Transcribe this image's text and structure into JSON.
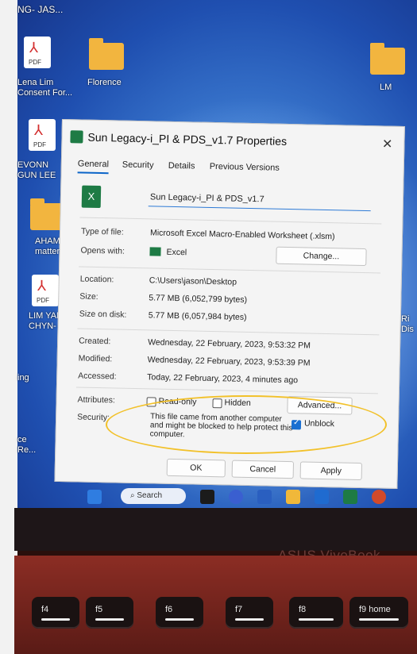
{
  "desktop": {
    "top_label": "NG- JAS...",
    "icons": [
      {
        "label": "Lena Lim Consent For...",
        "type": "pdf",
        "badge": "PDF"
      },
      {
        "label": "Florence",
        "type": "folder"
      },
      {
        "label": "LM",
        "type": "folder"
      },
      {
        "label": "EVONN GUN LEE",
        "type": "pdf",
        "badge": "PDF"
      },
      {
        "label": "AHAM matters",
        "type": "folder"
      },
      {
        "label": "LIM YAN CHYN- JA",
        "type": "pdf",
        "badge": "PDF"
      },
      {
        "label": "Ri Dis",
        "type": "file"
      },
      {
        "label": "ing",
        "type": "file"
      },
      {
        "label": "ce Re...",
        "type": "file"
      }
    ]
  },
  "dialog": {
    "title": "Sun Legacy-i_PI & PDS_v1.7 Properties",
    "close_glyph": "✕",
    "tabs": [
      "General",
      "Security",
      "Details",
      "Previous Versions"
    ],
    "active_tab": "General",
    "file_name": "Sun Legacy-i_PI & PDS_v1.7",
    "file_icon_letter": "X",
    "rows": {
      "type_label": "Type of file:",
      "type_value": "Microsoft Excel Macro-Enabled Worksheet (.xlsm)",
      "opens_label": "Opens with:",
      "opens_value": "Excel",
      "change_label": "Change...",
      "location_label": "Location:",
      "location_value": "C:\\Users\\jason\\Desktop",
      "size_label": "Size:",
      "size_value": "5.77 MB (6,052,799 bytes)",
      "size_on_disk_label": "Size on disk:",
      "size_on_disk_value": "5.77 MB (6,057,984 bytes)",
      "created_label": "Created:",
      "created_value": "Wednesday, 22 February, 2023, 9:53:32 PM",
      "modified_label": "Modified:",
      "modified_value": "Wednesday, 22 February, 2023, 9:53:39 PM",
      "accessed_label": "Accessed:",
      "accessed_value": "Today, 22 February, 2023, 4 minutes ago",
      "attributes_label": "Attributes:",
      "readonly_label": "Read-only",
      "hidden_label": "Hidden",
      "advanced_label": "Advanced...",
      "security_label": "Security:",
      "security_msg": "This file came from another computer and might be blocked to help protect this computer.",
      "unblock_label": "Unblock",
      "unblock_checked": true
    },
    "buttons": {
      "ok": "OK",
      "cancel": "Cancel",
      "apply": "Apply"
    }
  },
  "taskbar": {
    "search_label": "Search",
    "icons": [
      "windows-icon",
      "search-icon",
      "task-view-icon",
      "meet-icon",
      "word-icon",
      "file-explorer-icon",
      "mail-icon",
      "excel-icon",
      "powerpoint-icon"
    ]
  },
  "laptop": {
    "brand": "ASUS VivoBook",
    "keys": [
      "f4",
      "f5",
      "f6",
      "f7",
      "f8",
      "f9 home"
    ]
  },
  "colors": {
    "highlight_ellipse": "#f2c12a",
    "excel_green": "#1e7b45",
    "accent": "#1a6fd1"
  }
}
